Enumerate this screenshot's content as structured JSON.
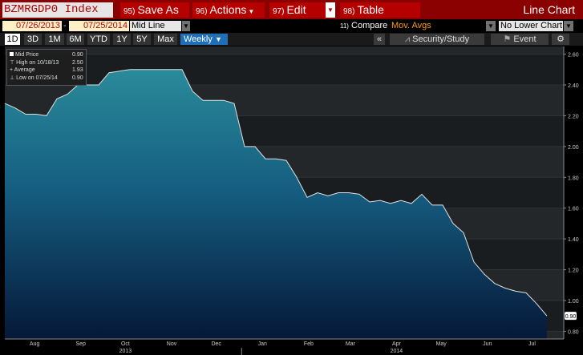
{
  "toolbar": {
    "ticker": "BZMRGDP0 Index",
    "buttons": [
      {
        "num": "95)",
        "label": "Save As"
      },
      {
        "num": "96)",
        "label": "Actions"
      },
      {
        "num": "97)",
        "label": "Edit"
      },
      {
        "num": "98)",
        "label": "Table"
      }
    ],
    "view": "Line Chart"
  },
  "controls": {
    "start_date": "07/26/2013",
    "end_date": "07/25/2014",
    "separator": "-",
    "field": "Mid Line",
    "compare_num": "11)",
    "compare_label": "Compare",
    "mov_avgs": "Mov. Avgs",
    "lower_chart": "No Lower Chart"
  },
  "periods": [
    "1D",
    "3D",
    "1M",
    "6M",
    "YTD",
    "1Y",
    "5Y",
    "Max"
  ],
  "active_period": "1D",
  "frequency": "Weekly",
  "tools": {
    "left_arrow": "«",
    "study": "Security/Study",
    "event": "Event",
    "settings_glyph": "⚙"
  },
  "legend": {
    "title": "Mid Price",
    "title_value": "0.90",
    "high_label": "High on 10/18/13",
    "high_value": "2.50",
    "avg_label": "Average",
    "avg_value": "1.93",
    "low_label": "Low on 07/25/14",
    "low_value": "0.90"
  },
  "last_value_tag": "0.90",
  "colors": {
    "header": "#8b0000",
    "button": "#b50000",
    "weekly": "#1f6fb8",
    "date_text": "#c00000",
    "mov_avgs": "#ff9900"
  },
  "chart_data": {
    "type": "area",
    "x": [
      "2013-07-26",
      "2013-08-02",
      "2013-08-09",
      "2013-08-16",
      "2013-08-23",
      "2013-08-30",
      "2013-09-06",
      "2013-09-13",
      "2013-09-20",
      "2013-09-27",
      "2013-10-04",
      "2013-10-11",
      "2013-10-18",
      "2013-10-25",
      "2013-11-01",
      "2013-11-08",
      "2013-11-15",
      "2013-11-22",
      "2013-11-29",
      "2013-12-06",
      "2013-12-13",
      "2013-12-20",
      "2013-12-27",
      "2014-01-03",
      "2014-01-10",
      "2014-01-17",
      "2014-01-24",
      "2014-01-31",
      "2014-02-07",
      "2014-02-14",
      "2014-02-21",
      "2014-02-28",
      "2014-03-07",
      "2014-03-14",
      "2014-03-21",
      "2014-03-28",
      "2014-04-04",
      "2014-04-11",
      "2014-04-18",
      "2014-04-25",
      "2014-05-02",
      "2014-05-09",
      "2014-05-16",
      "2014-05-23",
      "2014-05-30",
      "2014-06-06",
      "2014-06-13",
      "2014-06-20",
      "2014-06-27",
      "2014-07-04",
      "2014-07-11",
      "2014-07-18",
      "2014-07-25"
    ],
    "y": [
      2.28,
      2.25,
      2.21,
      2.21,
      2.2,
      2.31,
      2.34,
      2.4,
      2.4,
      2.4,
      2.48,
      2.49,
      2.5,
      2.5,
      2.5,
      2.5,
      2.5,
      2.5,
      2.36,
      2.3,
      2.3,
      2.3,
      2.28,
      2.0,
      2.0,
      1.92,
      1.92,
      1.91,
      1.8,
      1.67,
      1.7,
      1.68,
      1.7,
      1.7,
      1.69,
      1.64,
      1.65,
      1.63,
      1.65,
      1.63,
      1.69,
      1.62,
      1.62,
      1.5,
      1.44,
      1.25,
      1.17,
      1.11,
      1.08,
      1.06,
      1.05,
      0.98,
      0.9
    ],
    "ylim": [
      0.75,
      2.65
    ],
    "yticks": [
      "0.80",
      "1.00",
      "1.20",
      "1.40",
      "1.60",
      "1.80",
      "2.00",
      "2.20",
      "2.40",
      "2.60"
    ],
    "month_ticks": [
      {
        "label": "Aug",
        "date": "2013-08-15"
      },
      {
        "label": "Sep",
        "date": "2013-09-15"
      },
      {
        "label": "Oct",
        "date": "2013-10-15"
      },
      {
        "label": "Nov",
        "date": "2013-11-15"
      },
      {
        "label": "Dec",
        "date": "2013-12-15"
      },
      {
        "label": "Jan",
        "date": "2014-01-15"
      },
      {
        "label": "Feb",
        "date": "2014-02-15"
      },
      {
        "label": "Mar",
        "date": "2014-03-15"
      },
      {
        "label": "Apr",
        "date": "2014-04-15"
      },
      {
        "label": "May",
        "date": "2014-05-15"
      },
      {
        "label": "Jun",
        "date": "2014-06-15"
      },
      {
        "label": "Jul",
        "date": "2014-07-15"
      }
    ],
    "year_labels": [
      {
        "label": "2013",
        "date": "2013-10-15"
      },
      {
        "label": "2014",
        "date": "2014-04-15"
      }
    ],
    "grid": true
  }
}
